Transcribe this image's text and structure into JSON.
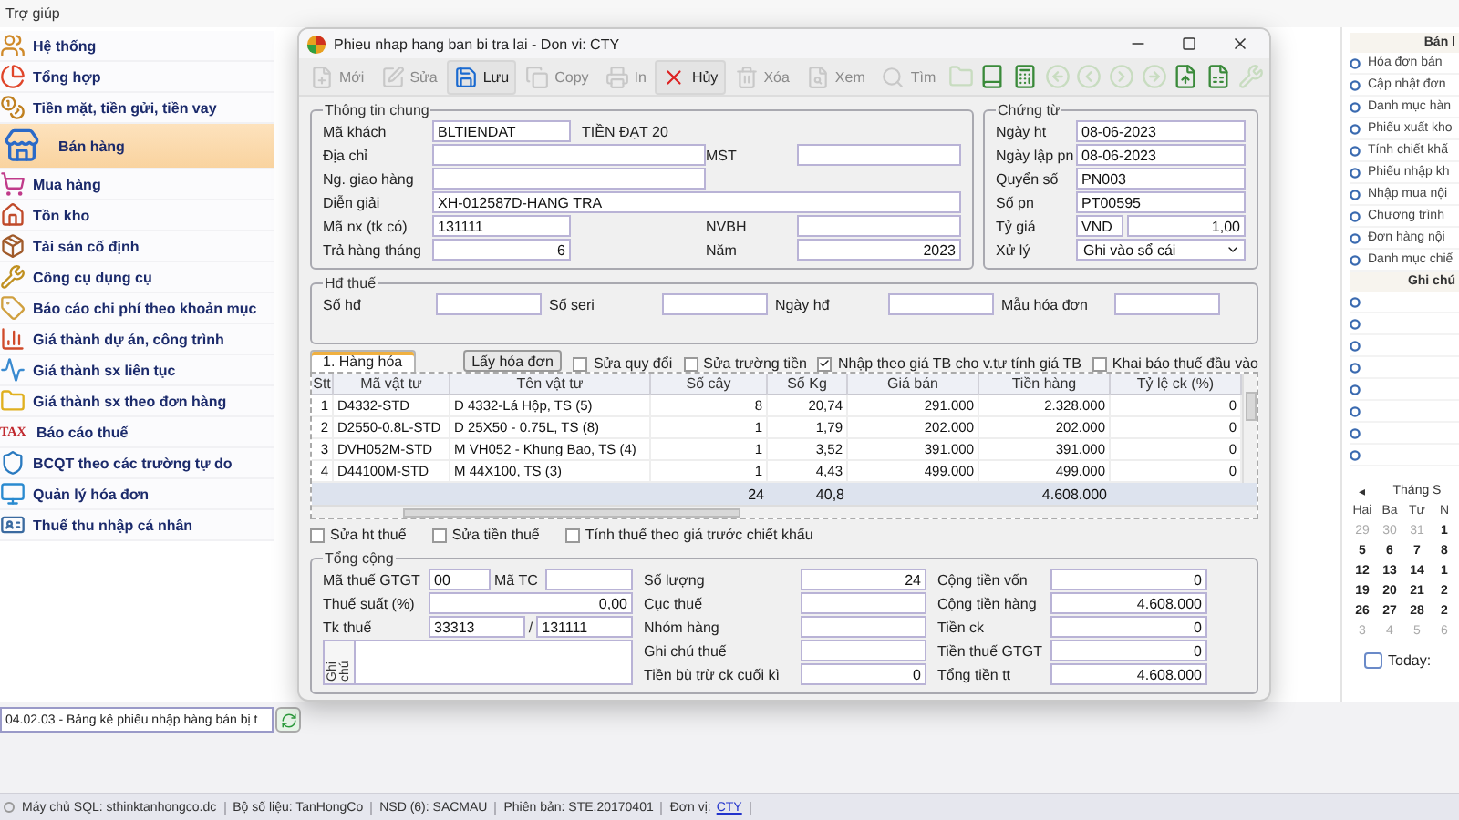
{
  "menu_bar": {
    "items": [
      "Trợ giúp"
    ]
  },
  "sidebar": {
    "items": [
      {
        "label": "Hệ thống",
        "selected": false
      },
      {
        "label": "Tổng hợp",
        "selected": false
      },
      {
        "label": "Tiền mặt, tiền gửi, tiền vay",
        "selected": false
      },
      {
        "label": "Bán hàng",
        "selected": true
      },
      {
        "label": "Mua hàng",
        "selected": false
      },
      {
        "label": "Tồn kho",
        "selected": false
      },
      {
        "label": "Tài sản cố định",
        "selected": false
      },
      {
        "label": "Công cụ dụng cụ",
        "selected": false
      },
      {
        "label": "Báo cáo chi phí theo khoản mục",
        "selected": false
      },
      {
        "label": "Giá thành dự án, công trình",
        "selected": false
      },
      {
        "label": "Giá thành sx liên tục",
        "selected": false
      },
      {
        "label": "Giá thành sx theo đơn hàng",
        "selected": false
      },
      {
        "label": "Báo cáo thuế",
        "selected": false,
        "badge": "TAX"
      },
      {
        "label": "BCQT theo các trường tự do",
        "selected": false
      },
      {
        "label": "Quản lý hóa đơn",
        "selected": false
      },
      {
        "label": "Thuế thu nhập cá nhân",
        "selected": false
      }
    ]
  },
  "dialog": {
    "title": "Phieu nhap hang ban bi tra lai - Don vi: CTY",
    "toolbar": {
      "buttons": [
        {
          "label": "Mới",
          "disabled": true
        },
        {
          "label": "Sửa",
          "disabled": true
        },
        {
          "label": "Lưu",
          "disabled": false
        },
        {
          "label": "Copy",
          "disabled": true
        },
        {
          "label": "In",
          "disabled": true
        },
        {
          "label": "Hủy",
          "disabled": false
        },
        {
          "label": "Xóa",
          "disabled": true
        },
        {
          "label": "Xem",
          "disabled": true
        },
        {
          "label": "Tìm",
          "disabled": true
        }
      ],
      "icon_buttons": [
        {
          "disabled": true
        },
        {
          "disabled": false
        },
        {
          "disabled": false
        },
        {
          "disabled": true
        },
        {
          "disabled": true
        },
        {
          "disabled": true
        },
        {
          "disabled": true
        },
        {
          "disabled": false
        },
        {
          "disabled": false
        },
        {
          "disabled": true
        }
      ]
    },
    "general": {
      "title": "Thông tin chung",
      "customer_name": "TIỀN ĐẠT 20",
      "fields": [
        {
          "label": "Mã khách",
          "value": "BLTIENDAT"
        },
        {
          "label": "Địa chỉ"
        },
        {
          "label": "MST"
        },
        {
          "label": "Ng. giao hàng"
        },
        {
          "label": "Diễn giải",
          "value": "XH-012587D-HANG TRA"
        },
        {
          "label": "Mã nx (tk có)",
          "value": "131111"
        },
        {
          "label": "NVBH"
        },
        {
          "label": "Trả hàng tháng",
          "value": "6"
        },
        {
          "label": "Năm",
          "value": "2023"
        }
      ]
    },
    "voucher": {
      "title": "Chứng từ",
      "fields": [
        {
          "label": "Ngày ht",
          "value": "08-06-2023"
        },
        {
          "label": "Ngày lập pn",
          "value": "08-06-2023"
        },
        {
          "label": "Quyển số",
          "value": "PN003"
        },
        {
          "label": "Số pn",
          "value": "PT00595"
        }
      ],
      "rate": {
        "label": "Tỷ giá",
        "currency": "VND",
        "value": "1,00"
      },
      "process": {
        "label": "Xử lý",
        "value": "Ghi vào sổ cái"
      }
    },
    "tax_invoice": {
      "title": "Hđ thuế",
      "fields": [
        {
          "label": "Số hđ"
        },
        {
          "label": "Số seri"
        },
        {
          "label": "Ngày hđ"
        },
        {
          "label": "Mẫu hóa đơn"
        }
      ]
    },
    "tabs": [
      {
        "label": "1. Hàng hóa",
        "selected": true
      }
    ],
    "fetch_button": "Lấy hóa đơn",
    "options": [
      {
        "label": "Sửa quy đổi",
        "checked": false
      },
      {
        "label": "Sửa trường tiền",
        "checked": false
      },
      {
        "label": "Nhập theo giá TB cho v.tư tính giá TB",
        "checked": true
      },
      {
        "label": "Khai báo thuế đầu vào",
        "checked": false
      }
    ],
    "grid": {
      "columns": [
        "Stt",
        "Mã vật tư",
        "Tên vật tư",
        "Số cây",
        "Số Kg",
        "Giá bán",
        "Tiền hàng",
        "Tỷ lệ ck (%)"
      ],
      "rows": [
        [
          "1",
          "D4332-STD",
          "D 4332-Lá Hộp, TS (5)",
          "8",
          "20,74",
          "291.000",
          "2.328.000",
          "0"
        ],
        [
          "2",
          "D2550-0.8L-STD",
          "D 25X50 - 0.75L, TS (8)",
          "1",
          "1,79",
          "202.000",
          "202.000",
          "0"
        ],
        [
          "3",
          "DVH052M-STD",
          "M VH052 - Khung Bao, TS (4)",
          "1",
          "3,52",
          "391.000",
          "391.000",
          "0"
        ],
        [
          "4",
          "D44100M-STD",
          "M 44X100, TS (3)",
          "1",
          "4,43",
          "499.000",
          "499.000",
          "0"
        ]
      ],
      "totals": {
        "quantity": "24",
        "weight": "40,8",
        "amount": "4.608.000"
      }
    },
    "tax_options": [
      {
        "label": "Sửa ht thuế",
        "checked": false
      },
      {
        "label": "Sửa tiền thuế",
        "checked": false
      },
      {
        "label": "Tính thuế theo giá trước chiết khấu",
        "checked": false
      }
    ],
    "totals": {
      "title": "Tổng cộng",
      "vat_code": {
        "label": "Mã thuế GTGT",
        "value": "00"
      },
      "tc_code": {
        "label": "Mã TC"
      },
      "tax_rate": {
        "label": "Thuế suất (%)",
        "value": "0,00"
      },
      "tax_account": {
        "label": "Tk thuế",
        "value": "33313",
        "separator": "/",
        "value2": "131111"
      },
      "note": {
        "label": "Ghi chú"
      },
      "middle": [
        {
          "label": "Số lượng",
          "value": "24"
        },
        {
          "label": "Cục thuế"
        },
        {
          "label": "Nhóm hàng"
        },
        {
          "label": "Ghi chú thuế"
        },
        {
          "label": "Tiền bù trừ ck cuối kì",
          "value": "0"
        }
      ],
      "right": [
        {
          "label": "Cộng tiền vốn",
          "value": "0"
        },
        {
          "label": "Cộng tiền hàng",
          "value": "4.608.000"
        },
        {
          "label": "Tiền ck",
          "value": "0"
        },
        {
          "label": "Tiền thuế GTGT",
          "value": "0"
        },
        {
          "label": "Tổng tiền tt",
          "value": "4.608.000"
        }
      ]
    }
  },
  "right_panel": {
    "title": "Bán l",
    "items": [
      "Hóa đơn bán",
      "Cập nhật đơn",
      "Danh mục hàn",
      "Phiếu xuất kho",
      "Tính chiết khấ",
      "Phiếu nhập kh",
      "Nhập mua nội",
      "Chương trình",
      "Đơn hàng nội",
      "Danh mục chiế"
    ],
    "notes_title": "Ghi chú",
    "calendar": {
      "prev": "◂",
      "month": "Tháng S",
      "weekdays": [
        "Hai",
        "Ba",
        "Tư",
        "N"
      ],
      "weeks": [
        [
          {
            "day": "29",
            "dimmed": true
          },
          {
            "day": "30",
            "dimmed": true
          },
          {
            "day": "31",
            "dimmed": true
          },
          {
            "day": "1",
            "dimmed": false
          }
        ],
        [
          {
            "day": "5",
            "dimmed": false
          },
          {
            "day": "6",
            "dimmed": false
          },
          {
            "day": "7",
            "dimmed": false
          },
          {
            "day": "8",
            "dimmed": false
          }
        ],
        [
          {
            "day": "12",
            "dimmed": false
          },
          {
            "day": "13",
            "dimmed": false
          },
          {
            "day": "14",
            "dimmed": false
          },
          {
            "day": "1",
            "dimmed": false
          }
        ],
        [
          {
            "day": "19",
            "dimmed": false
          },
          {
            "day": "20",
            "dimmed": false
          },
          {
            "day": "21",
            "dimmed": false
          },
          {
            "day": "2",
            "dimmed": false
          }
        ],
        [
          {
            "day": "26",
            "dimmed": false
          },
          {
            "day": "27",
            "dimmed": false
          },
          {
            "day": "28",
            "dimmed": false
          },
          {
            "day": "2",
            "dimmed": false
          }
        ],
        [
          {
            "day": "3",
            "dimmed": true
          },
          {
            "day": "4",
            "dimmed": true
          },
          {
            "day": "5",
            "dimmed": true
          },
          {
            "day": "6",
            "dimmed": true
          }
        ]
      ],
      "today_label": "Today:",
      "today_checked": false
    }
  },
  "report_field": {
    "value": "04.02.03 - Bảng kê phiếu nhập hàng bán bị t"
  },
  "status_bar": {
    "items": [
      "Máy chủ SQL: sthinktanhongco.dc",
      "Bộ số liệu: TanHongCo",
      "NSD (6): SACMAU",
      "Phiên bản: STE.20170401"
    ],
    "unit_label": "Đơn vị:",
    "unit_link": "CTY"
  }
}
